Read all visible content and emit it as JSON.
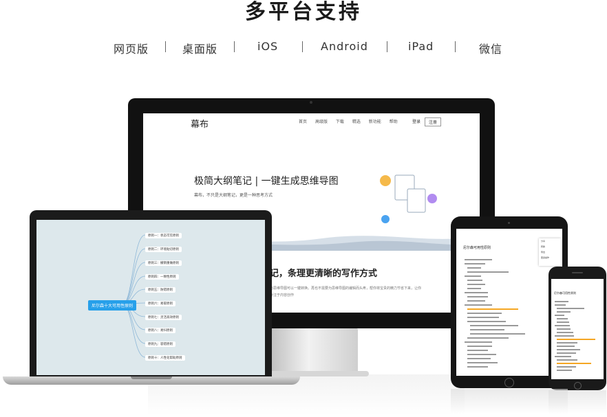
{
  "title": "多平台支持",
  "platforms": [
    "网页版",
    "桌面版",
    "iOS",
    "Android",
    "iPad",
    "微信"
  ],
  "monitor": {
    "logo": "幕布",
    "nav": [
      "首页",
      "高级版",
      "下载",
      "精选",
      "新功能",
      "帮助"
    ],
    "login": "登录",
    "signup": "注册",
    "hero_title": "极简大纲笔记 | 一键生成思维导图",
    "hero_sub": "幕布，不只是大纲笔记，更是一种思考方式",
    "section_title": "记，条理更清晰的写作方式",
    "section_text": "与思维导图可以一键转换。再也不需要为思维导图的编辑而头疼，帮你将宝贵的精力节省下来，让你专注于内容创作"
  },
  "laptop": {
    "root": "尼尔森十大可用性原则",
    "nodes": [
      "原则一：状态可见原则",
      "原则二：环境贴切原则",
      "原则三：撤销重做原则",
      "原则四：一致性原则",
      "原则五：防错原则",
      "原则六：易取原则",
      "原则七：灵活高效原则",
      "原则八：易扫原则",
      "原则九：容错原则",
      "原则十：人性化帮助原则"
    ]
  },
  "tablet": {
    "doc_title": "尼尔森可用性原则",
    "menu": [
      "分享",
      "转换",
      "导出",
      "更多操作"
    ]
  },
  "phone": {
    "doc_title": "尼尔森可用性原则"
  }
}
